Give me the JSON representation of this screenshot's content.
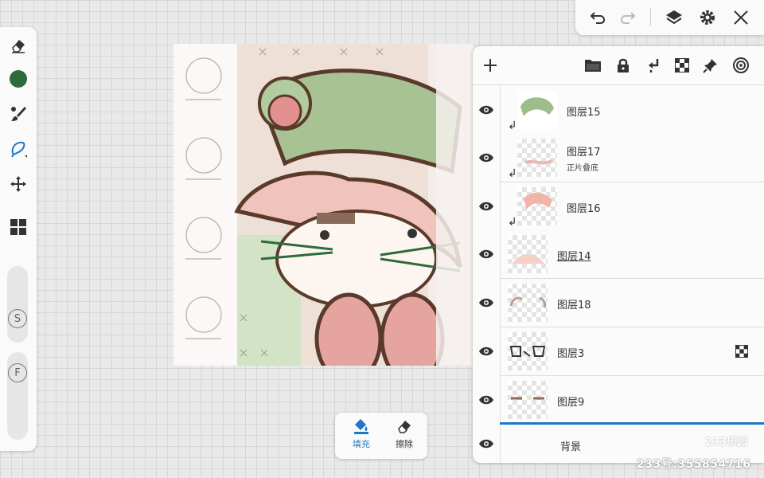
{
  "colors": {
    "accent": "#1f77c7",
    "brush_color": "#2e6b3a",
    "layer_active": "#1f77c7"
  },
  "left_toolbar": {
    "icons": [
      "eraser-icon",
      "color-swatch",
      "brush-icon",
      "lasso-icon",
      "move-icon",
      "grid-icon"
    ],
    "size_label": "S",
    "flow_label": "F"
  },
  "top_toolbar": {
    "icons": [
      "undo-icon",
      "redo-icon",
      "layers-icon",
      "gear-icon",
      "close-icon"
    ]
  },
  "layers_panel": {
    "header_icons": [
      "add-icon",
      "folder-icon",
      "lock-icon",
      "clip-icon",
      "checker-icon",
      "pin-icon",
      "target-icon"
    ],
    "layers": [
      {
        "name": "图层15",
        "sub": "",
        "clipped": true
      },
      {
        "name": "图层17",
        "sub": "正片叠底",
        "clipped": true
      },
      {
        "name": "图层16",
        "sub": "",
        "clipped": true
      },
      {
        "name": "图层14",
        "sub": "",
        "clipped": false,
        "underlined": true
      },
      {
        "name": "图层18",
        "sub": "",
        "clipped": false
      },
      {
        "name": "图层3",
        "sub": "",
        "clipped": false,
        "badge": "checker"
      },
      {
        "name": "图层9",
        "sub": "",
        "clipped": false,
        "active": true
      },
      {
        "name": "背景",
        "sub": "",
        "clipped": false
      }
    ]
  },
  "fill_popup": {
    "fill_label": "填充",
    "erase_label": "擦除"
  },
  "watermark": {
    "text": "233号:355854716",
    "logo": "233乐园"
  }
}
